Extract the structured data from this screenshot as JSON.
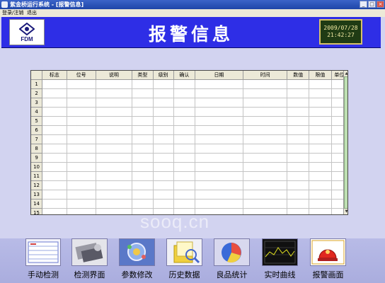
{
  "window": {
    "title": "紫金桥运行系统 - [报警信息]"
  },
  "menu": {
    "items": [
      "登录/注销",
      "退出"
    ]
  },
  "header": {
    "title": "报警信息",
    "logo_text": "FDM",
    "date": "2009/07/28",
    "time": "21:42:27"
  },
  "grid": {
    "columns": [
      "标志",
      "位号",
      "说明",
      "类型",
      "级别",
      "确认",
      "日期",
      "时间",
      "数值",
      "限值",
      "单位"
    ],
    "row_numbers": [
      "1",
      "2",
      "3",
      "4",
      "5",
      "6",
      "7",
      "8",
      "9",
      "10",
      "11",
      "12",
      "13",
      "14",
      "15"
    ]
  },
  "nav": {
    "buttons": [
      {
        "label": "手动检测",
        "icon": "manual-test-icon"
      },
      {
        "label": "检测界面",
        "icon": "detection-screen-icon"
      },
      {
        "label": "参数修改",
        "icon": "parameter-edit-icon"
      },
      {
        "label": "历史数据",
        "icon": "history-data-icon"
      },
      {
        "label": "良品统计",
        "icon": "quality-stats-icon"
      },
      {
        "label": "实时曲线",
        "icon": "realtime-curve-icon"
      },
      {
        "label": "报警画面",
        "icon": "alarm-screen-icon"
      }
    ]
  },
  "watermark": "sooq.cn",
  "colors": {
    "header": "#2e2ee6",
    "background": "#d2d3f0",
    "clock_text": "#f0e8a0",
    "scroll_thumb": "#bfe0b3"
  }
}
